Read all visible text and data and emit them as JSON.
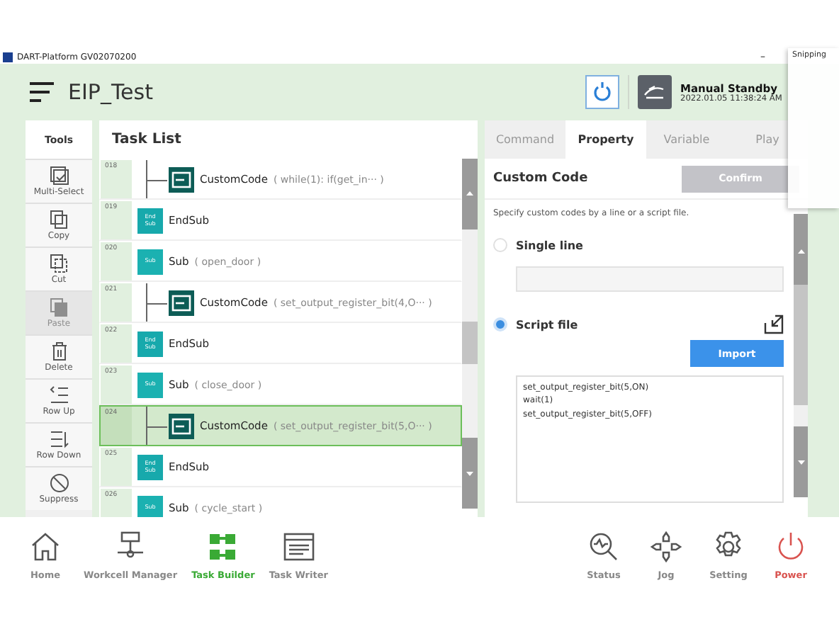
{
  "titlebar": {
    "title": "DART-Platform GV02070200",
    "minimize": "–"
  },
  "overlay_window": {
    "title": "Snipping"
  },
  "header": {
    "project": "EIP_Test",
    "status": "Manual Standby",
    "datetime": "2022.01.05 11:38:24 AM"
  },
  "tools": {
    "title": "Tools",
    "items": [
      {
        "label": "Multi-Select",
        "disabled": false
      },
      {
        "label": "Copy",
        "disabled": false
      },
      {
        "label": "Cut",
        "disabled": false
      },
      {
        "label": "Paste",
        "disabled": true
      },
      {
        "label": "Delete",
        "disabled": false
      },
      {
        "label": "Row Up",
        "disabled": false
      },
      {
        "label": "Row Down",
        "disabled": false
      },
      {
        "label": "Suppress",
        "disabled": false
      }
    ]
  },
  "task_list": {
    "title": "Task List",
    "rows": [
      {
        "children": [
          {
            "number": "018",
            "kind": "custom",
            "name": "CustomCode",
            "arg": "( while(1):      if(get_in··· )",
            "selected": false
          }
        ]
      },
      {
        "number": "019",
        "kind": "endsub",
        "badge": "End Sub",
        "name": "EndSub",
        "selected": false
      },
      {
        "number": "020",
        "kind": "sub",
        "badge": "Sub",
        "name": "Sub",
        "arg": "( open_door )",
        "selected": false,
        "children": [
          {
            "number": "021",
            "kind": "custom",
            "name": "CustomCode",
            "arg": "( set_output_register_bit(4,O··· )",
            "selected": false
          }
        ]
      },
      {
        "number": "022",
        "kind": "endsub",
        "badge": "End Sub",
        "name": "EndSub",
        "selected": false
      },
      {
        "number": "023",
        "kind": "sub",
        "badge": "Sub",
        "name": "Sub",
        "arg": "( close_door )",
        "selected": false,
        "children": [
          {
            "number": "024",
            "kind": "custom",
            "name": "CustomCode",
            "arg": "( set_output_register_bit(5,O··· )",
            "selected": true
          }
        ]
      },
      {
        "number": "025",
        "kind": "endsub",
        "badge": "End Sub",
        "name": "EndSub",
        "selected": false
      },
      {
        "number": "026",
        "kind": "sub",
        "badge": "Sub",
        "name": "Sub",
        "arg": "( cycle_start )",
        "selected": false
      }
    ]
  },
  "right_panel": {
    "tabs": [
      {
        "label": "Command",
        "selected": false
      },
      {
        "label": "Property",
        "selected": true
      },
      {
        "label": "Variable",
        "selected": false
      },
      {
        "label": "Play",
        "selected": false
      }
    ],
    "title": "Custom Code",
    "confirm": "Confirm",
    "description": "Specify custom codes by a line or a script file.",
    "options": [
      {
        "label": "Single line",
        "selected": false
      },
      {
        "label": "Script file",
        "selected": true
      }
    ],
    "import": "Import",
    "script_lines": [
      "set_output_register_bit(5,ON)",
      "wait(1)",
      "set_output_register_bit(5,OFF)"
    ]
  },
  "bottom_nav": [
    {
      "label": "Home",
      "selected": false,
      "kind": "normal"
    },
    {
      "label": "Workcell Manager",
      "selected": false,
      "kind": "normal"
    },
    {
      "label": "Task Builder",
      "selected": true,
      "kind": "normal"
    },
    {
      "label": "Task Writer",
      "selected": false,
      "kind": "normal"
    },
    {
      "label": "Status",
      "selected": false,
      "kind": "normal"
    },
    {
      "label": "Jog",
      "selected": false,
      "kind": "normal"
    },
    {
      "label": "Setting",
      "selected": false,
      "kind": "normal"
    },
    {
      "label": "Power",
      "selected": false,
      "kind": "power"
    }
  ]
}
